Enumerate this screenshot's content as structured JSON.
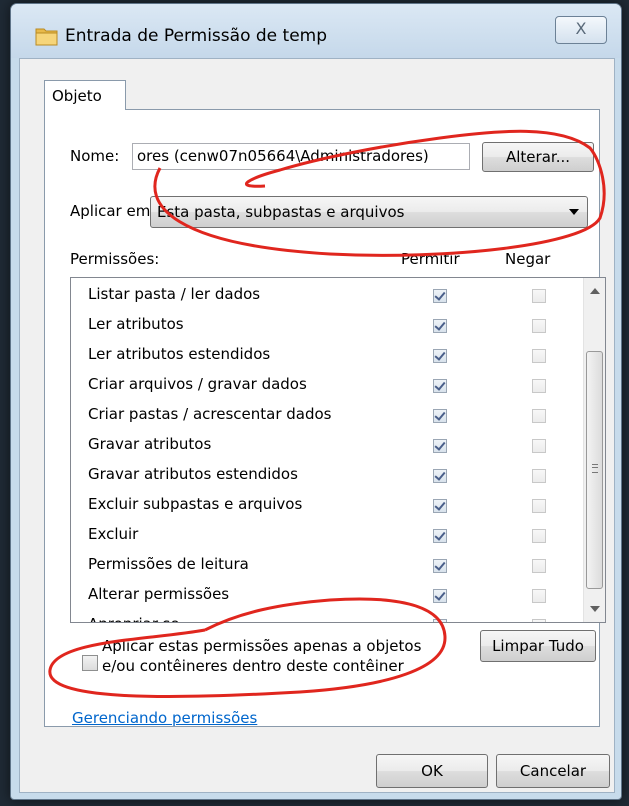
{
  "window": {
    "title": "Entrada de Permissão de temp",
    "close_glyph": "X"
  },
  "tabs": [
    {
      "label": "Objeto",
      "selected": true
    }
  ],
  "name_field": {
    "label": "Nome:",
    "value": "ores (cenw07n05664\\Administradores)",
    "change_button": "Alterar..."
  },
  "apply_to": {
    "label": "Aplicar em:",
    "selected": "Esta pasta, subpastas e arquivos"
  },
  "permissions": {
    "header_label": "Permissões:",
    "col_allow": "Permitir",
    "col_deny": "Negar",
    "rows": [
      {
        "label": "Listar pasta / ler dados",
        "allow": true,
        "deny": false
      },
      {
        "label": "Ler atributos",
        "allow": true,
        "deny": false
      },
      {
        "label": "Ler atributos estendidos",
        "allow": true,
        "deny": false
      },
      {
        "label": "Criar arquivos / gravar dados",
        "allow": true,
        "deny": false
      },
      {
        "label": "Criar pastas / acrescentar dados",
        "allow": true,
        "deny": false
      },
      {
        "label": "Gravar atributos",
        "allow": true,
        "deny": false
      },
      {
        "label": "Gravar atributos estendidos",
        "allow": true,
        "deny": false
      },
      {
        "label": "Excluir subpastas e arquivos",
        "allow": true,
        "deny": false
      },
      {
        "label": "Excluir",
        "allow": true,
        "deny": false
      },
      {
        "label": "Permissões de leitura",
        "allow": true,
        "deny": false
      },
      {
        "label": "Alterar permissões",
        "allow": true,
        "deny": false
      },
      {
        "label": "Apropriar-se",
        "allow": true,
        "deny": false
      }
    ]
  },
  "apply_only": {
    "checked": false,
    "line1": "Aplicar estas permissões apenas a objetos",
    "line2": "e/ou contêineres dentro deste contêiner"
  },
  "clear_all_button": "Limpar Tudo",
  "manage_link": "Gerenciando permissões",
  "footer": {
    "ok": "OK",
    "cancel": "Cancelar"
  },
  "annotation_color": "#e0261e"
}
